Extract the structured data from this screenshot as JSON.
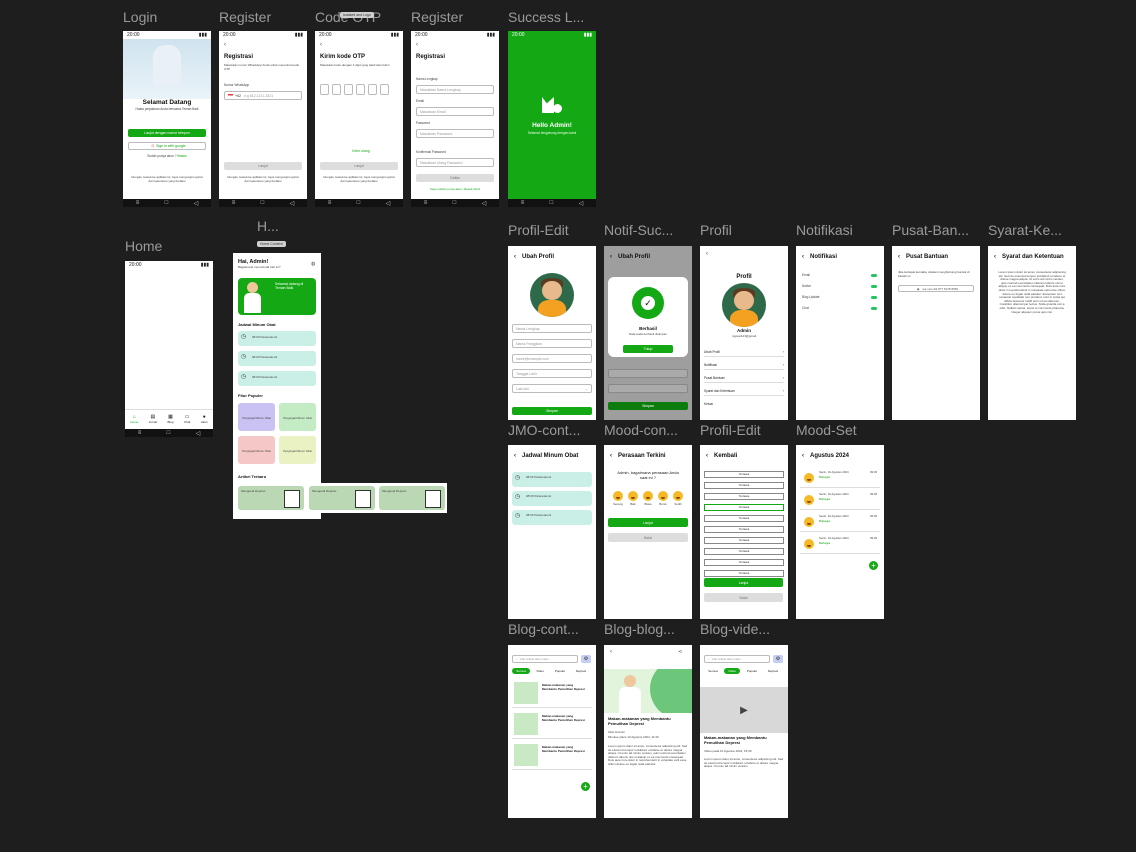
{
  "labels": {
    "login": "Login",
    "register1": "Register",
    "code": "Code OTP",
    "register2": "Register",
    "success": "Success L...",
    "home": "Home",
    "home2": "H...",
    "profile_edit": "Profil-Edit",
    "notif_success": "Notif-Suc...",
    "profil": "Profil",
    "notifikasi": "Notifikasi",
    "pusat_bantuan": "Pusat-Ban...",
    "syarat": "Syarat-Ke...",
    "jmo": "JMO-cont...",
    "mood_con": "Mood-con...",
    "profil_edit2": "Profil-Edit",
    "mood_set": "Mood-Set",
    "blog_cont": "Blog-cont...",
    "blog_blog": "Blog-blog...",
    "blog_video": "Blog-vide..."
  },
  "status_time": "20:00",
  "login": {
    "title": "Selamat Datang",
    "subtitle": "Huala perjalanan Anda bersama Teman Baik",
    "google_btn": "Lanjut dengan nomor telepon",
    "google2": "Sign in with google",
    "has_account": "Sudah punya akun ?",
    "masuk": "Masuk",
    "footer": "Dengan masuk ke aplikasi ini, saya menyetujui syarat dan ketentuan yang berlaku"
  },
  "register1": {
    "title": "Registrasi",
    "desc": "Masukkan nomor WhatsApp Anda untuk menerima kode OTP",
    "phone_label": "Nomor WhatsApp",
    "phone_code": "+62",
    "phone_placeholder": "e.g 812-1121-3321",
    "btn": "Lanjut"
  },
  "otp": {
    "title": "Kirim kode OTP",
    "desc": "Masukkan kode dengan 4 digit yang telah kami kirim",
    "resend": "Kirim ulang",
    "btn": "Lanjut",
    "tooltip": "Isolated and Logo"
  },
  "register2": {
    "title": "Registrasi",
    "name_label": "Nama Lengkap",
    "name_ph": "Masukkan Nama Lengkap",
    "email_label": "Email",
    "email_ph": "Masukkan Email",
    "pass_label": "Password",
    "pass_ph": "Masukkan Password",
    "confirm_label": "Konfirmasi Password",
    "confirm_ph": "Masukkan Ulang Password",
    "btn": "Daftar",
    "login_link": "Saya sudah punya akun. Masuk disini"
  },
  "success": {
    "title": "Hello Admin!",
    "sub": "Selamat bergabung dengan kami"
  },
  "home2": {
    "badge": "Home Content",
    "greet": "Hai, Admin!",
    "sub": "Bagaimana mood Anda hari ini?",
    "banner_title": "Selamat datang di Teman Baik",
    "section_obat": "Jadwal Minum Obat",
    "obat_items": [
      "08:00 Paracetamol",
      "08:00 Paracetamol",
      "08:00 Paracetamol"
    ],
    "section_fitur": "Fitur Populer",
    "fitur": [
      "Pengingat Minum Obat",
      "Pengingat Minum Obat",
      "Pengingat Minum Obat",
      "Pengingat Minum Obat"
    ],
    "section_artikel": "Artikel Terbaru",
    "artikel": [
      "Mengenal Depresi",
      "Mengenal Depresi",
      "Mengenal Depresi"
    ]
  },
  "profile_edit": {
    "title": "Ubah Profil",
    "fields": [
      "Nama Lengkap",
      "Nama Panggilan",
      "name@example.com",
      "Tanggal Lahir",
      "Laki laki"
    ],
    "btn": "Simpan"
  },
  "notif": {
    "title": "Ubah Profil",
    "success": "Berhasil",
    "desc": "Data anda berhasil disimpan",
    "btn": "Tutup",
    "save": "Simpan"
  },
  "profil": {
    "title": "Profil",
    "name": "Admin",
    "email": "mgtest123@gmail",
    "menu": [
      "Ubah Profil",
      "Notifikasi",
      "Pusat Bantuan",
      "Syarat dan Ketentuan",
      "Keluar"
    ]
  },
  "notifikasi": {
    "title": "Notifikasi",
    "items": [
      "Email",
      "Notice",
      "Blog Update",
      "Chat"
    ]
  },
  "bantuan": {
    "title": "Pusat Bantuan",
    "desc": "Jika terdapat kendala, silakan menghubungi kontak di bawah ini",
    "contact": "wa.me/+62 877 6278 8350"
  },
  "syarat": {
    "title": "Syarat dan Ketentuan",
    "body": "Lorem ipsum dolor sit amet, consectetur adipiscing elit. Sed do eiusmod tempor incididunt ut labore et dolore magna aliqua. Ut enim ad minim veniam, quis nostrud exercitation ullamco laboris nisi ut aliquip ex ea commodo consequat. Duis aute irure dolor in reprehenderit in voluptate velit esse cillum dolore eu fugiat nulla pariatur. Excepteur sint occaecat cupidatat non proident, sunt in culpa qui officia deserunt mollit anim id est laborum. Curabitur ullamcorper lectus. Nulla gravida orci a odio. Nullam varius, turpis et commodo pharetra, integer aliquam purus quis nisi."
  },
  "jmo": {
    "title": "Jadwal Minum Obat",
    "items": [
      "08:00 Paracetamol",
      "08:00 Paracetamol",
      "08:00 Paracetamol"
    ]
  },
  "mood": {
    "title": "Perasaan Terkini",
    "question": "Admin, bagaimana perasaan Anda saat ini ?",
    "faces": [
      "Senang",
      "Baik",
      "Biasa",
      "Buruk",
      "Sedih"
    ],
    "btn": "Lanjut",
    "btn2": "Batal"
  },
  "profil_edit2": {
    "title": "Kembali",
    "options": [
      "Tertawa",
      "Tertawa",
      "Tertawa",
      "Tertawa",
      "Tertawa",
      "Tertawa",
      "Tertawa",
      "Tertawa",
      "Tertawa",
      "Tertawa"
    ],
    "btn": "Lanjut",
    "btn2": "Batal"
  },
  "mood_set": {
    "title": "Agustus 2024",
    "entries": [
      {
        "date": "Senin, 19 Agustus 2024",
        "mood": "Bahagia",
        "time": "09:00"
      },
      {
        "date": "Senin, 19 Agustus 2024",
        "mood": "Bahagia",
        "time": "09:00"
      },
      {
        "date": "Senin, 19 Agustus 2024",
        "mood": "Bahagia",
        "time": "09:00"
      },
      {
        "date": "Senin, 19 Agustus 2024",
        "mood": "Bahagia",
        "time": "09:00"
      }
    ]
  },
  "blog_cont": {
    "search": "Cari artikel atau video",
    "tabs": [
      "Semua",
      "Video",
      "Populer",
      "Depresi"
    ],
    "items": [
      "Makan-makanan yang Membantu Pemulihan Depresi",
      "Makan-makanan yang Membantu Pemulihan Depresi",
      "Makan-makanan yang Membantu Pemulihan Depresi"
    ]
  },
  "blog_blog": {
    "title": "Makan-makanan yang Membantu Pemulihan Depresi",
    "author": "Oleh Anonim",
    "meta": "Minutes place 10 Agustus 2024, 11:30",
    "body": "Lorem ipsum dolor sit amet, consectetur adipiscing elit. Sed do eiusmod tempor incididunt ut labore et dolore magna aliqua. Ut enim ad minim veniam, quis nostrud exercitation ullamco laboris nisi ut aliquip ex ea commodo consequat. Duis aute irure dolor in reprehenderit in voluptate velit esse cillum dolore eu fugiat nulla pariatur."
  },
  "blog_video": {
    "search": "Cari artikel atau video",
    "tabs": [
      "Semua",
      "Video",
      "Populer",
      "Depresi"
    ],
    "title": "Makan-makanan yang Membantu Pemulihan Depresi",
    "meta": "Video pada 10 Agustus 2024, 15:30",
    "body": "Lorem ipsum dolor sit amet, consectetur adipiscing elit. Sed do eiusmod tempor incididunt ut labore et dolore magna aliqua. Ut enim ad minim veniam."
  },
  "home_nav": [
    "Home",
    "Jurnal",
    "Blog",
    "Chat",
    "Akun"
  ]
}
